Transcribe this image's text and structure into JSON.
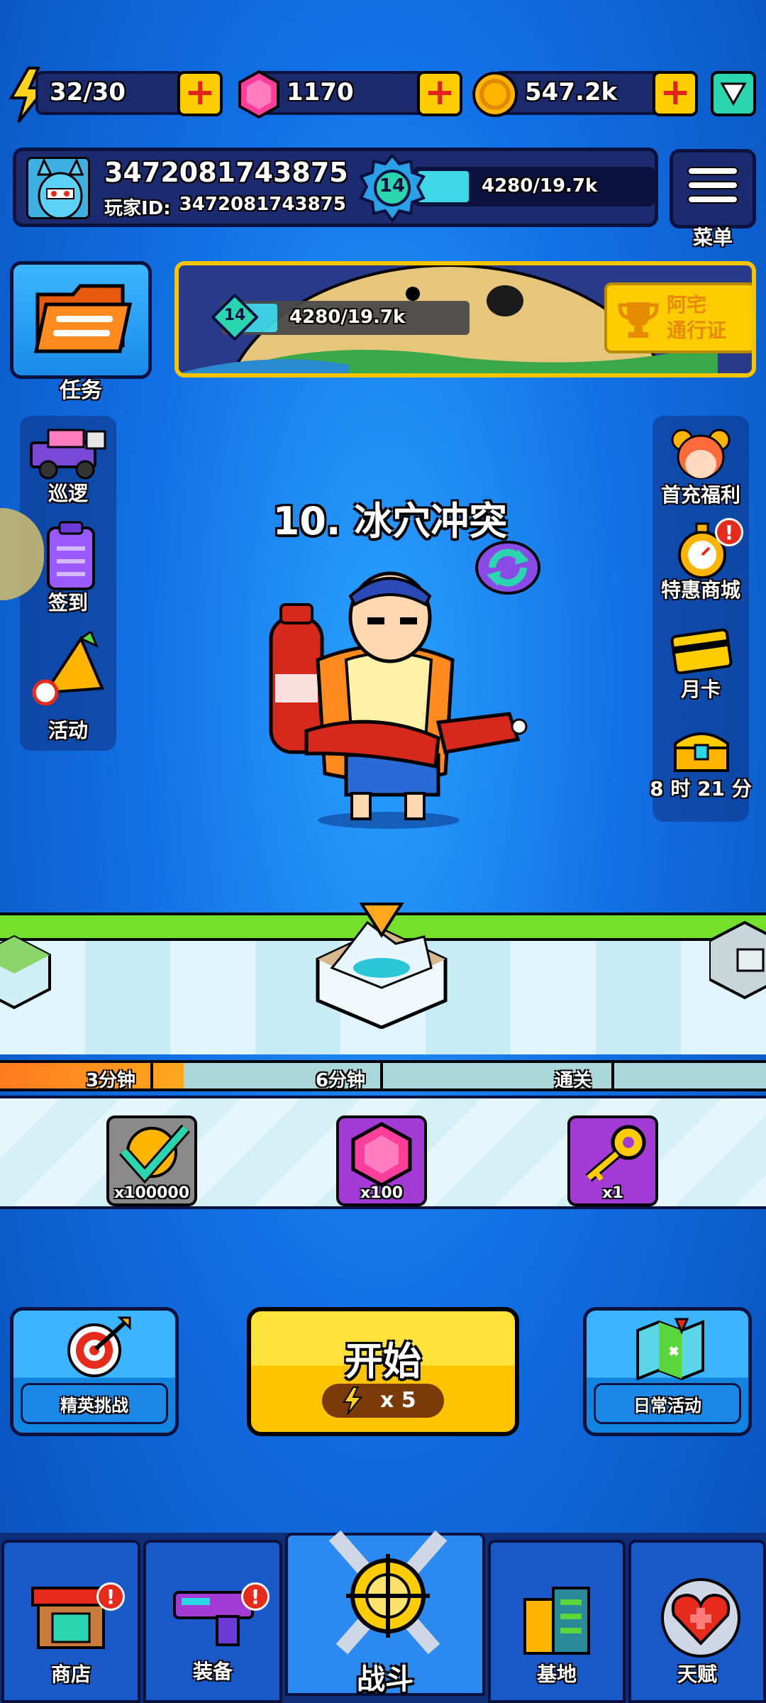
{
  "resources": {
    "energy": "32/30",
    "gems": "1170",
    "coins": "547.2k"
  },
  "player": {
    "name": "3472081743875",
    "id_label": "玩家ID:",
    "id_value": "3472081743875",
    "level": "14",
    "xp": "4280/19.7k",
    "xp_fraction": 0.22
  },
  "menu": {
    "label": "菜单"
  },
  "task": {
    "label": "任务"
  },
  "pass": {
    "level": "14",
    "xp": "4280/19.7k",
    "xp_fraction": 0.22,
    "title_line1": "阿宅",
    "title_line2": "通行证"
  },
  "left_menu": [
    {
      "label": "巡逻",
      "icon": "truck-icon"
    },
    {
      "label": "签到",
      "icon": "clipboard-icon"
    },
    {
      "label": "活动",
      "icon": "megaphone-icon"
    }
  ],
  "right_menu": [
    {
      "label": "首充福利",
      "icon": "girl-avatar-icon"
    },
    {
      "label": "特惠商城",
      "icon": "stopwatch-icon"
    },
    {
      "label": "月卡",
      "icon": "card-icon"
    },
    {
      "label": "8 时 21 分",
      "icon": "chest-icon"
    }
  ],
  "stage": {
    "title": "10. 冰穴冲突"
  },
  "progress": {
    "milestones": [
      "3分钟",
      "6分钟",
      "通关"
    ],
    "fill_fraction": 0.24
  },
  "rewards": [
    {
      "qty": "x100000",
      "icon": "coin-check-icon",
      "color": "#8a8a8a"
    },
    {
      "qty": "x100",
      "icon": "gem-icon",
      "color": "#a43ad6"
    },
    {
      "qty": "x1",
      "icon": "key-icon",
      "color": "#a43ad6"
    }
  ],
  "actions": {
    "elite_label": "精英挑战",
    "daily_label": "日常活动",
    "start_label": "开始",
    "start_cost": "x 5"
  },
  "nav": [
    {
      "label": "商店",
      "icon": "shop-icon"
    },
    {
      "label": "装备",
      "icon": "gun-icon"
    },
    {
      "label": "战斗",
      "icon": "crosshair-swords-icon"
    },
    {
      "label": "基地",
      "icon": "building-icon"
    },
    {
      "label": "天赋",
      "icon": "heart-shield-icon"
    }
  ],
  "colors": {
    "accent_yellow": "#ffcc00",
    "badge_red": "#e62a1c",
    "panel_navy": "#1c2a70"
  }
}
